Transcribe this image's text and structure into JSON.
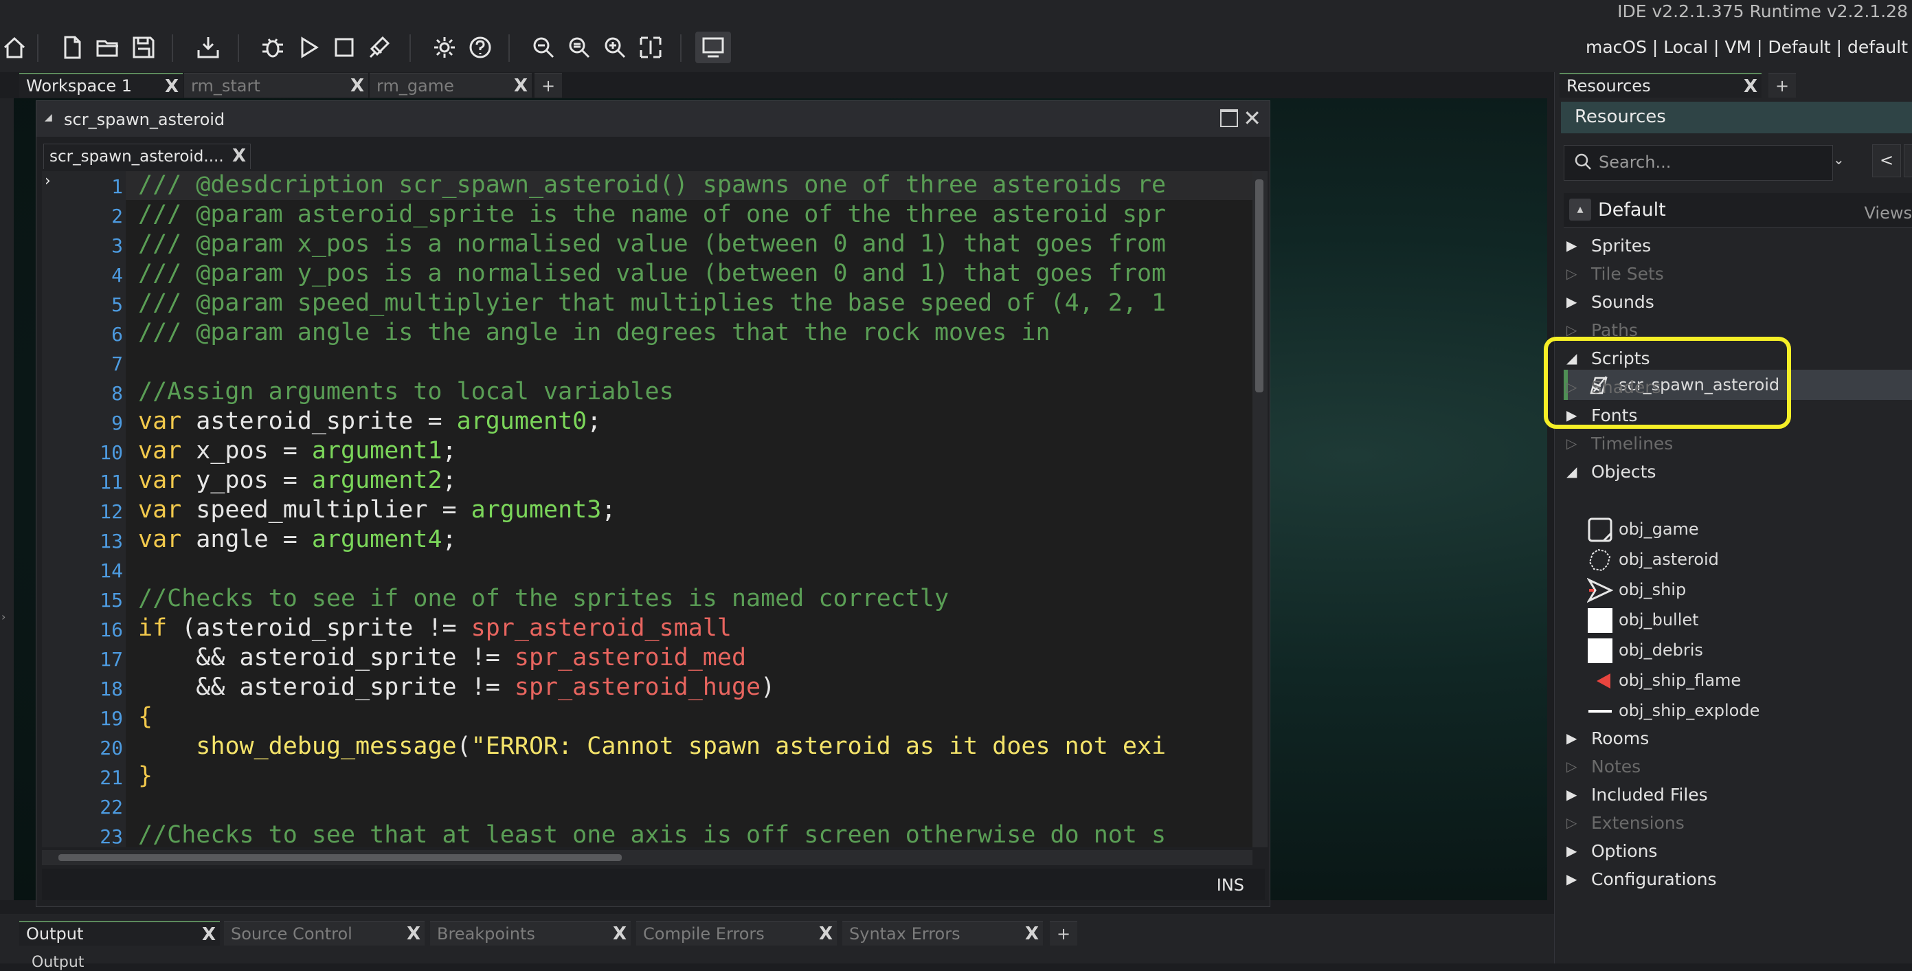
{
  "app": {
    "version": "IDE v2.2.1.375  Runtime v2.2.1.28",
    "target": "macOS | Local | VM | Default | default"
  },
  "toolbar": {
    "icons": [
      "home-icon",
      "new-file-icon",
      "open-folder-icon",
      "save-icon",
      "export-icon",
      "debug-icon",
      "play-icon",
      "stop-icon",
      "clean-icon",
      "settings-icon",
      "help-icon",
      "zoom-out-icon",
      "zoom-reset-icon",
      "zoom-in-icon",
      "fit-icon",
      "window-icon"
    ]
  },
  "workspace_tabs": [
    {
      "label": "Workspace 1",
      "active": true
    },
    {
      "label": "rm_start",
      "active": false
    },
    {
      "label": "rm_game",
      "active": false
    }
  ],
  "plus": "+",
  "code_window": {
    "title": "scr_spawn_asteroid",
    "subtab": "scr_spawn_asteroid....",
    "status": "INS",
    "line_numbers": [
      "1",
      "2",
      "3",
      "4",
      "5",
      "6",
      "7",
      "8",
      "9",
      "10",
      "11",
      "12",
      "13",
      "14",
      "15",
      "16",
      "17",
      "18",
      "19",
      "20",
      "21",
      "22",
      "23"
    ],
    "lines": [
      [
        {
          "c": "cm",
          "t": "/// @desdcription scr_spawn_asteroid() spawns one of three asteroids re"
        }
      ],
      [
        {
          "c": "cm",
          "t": "/// @param asteroid_sprite is the name of one of the three asteroid spr"
        }
      ],
      [
        {
          "c": "cm",
          "t": "/// @param x_pos is a normalised value (between 0 and 1) that goes from"
        }
      ],
      [
        {
          "c": "cm",
          "t": "/// @param y_pos is a normalised value (between 0 and 1) that goes from"
        }
      ],
      [
        {
          "c": "cm",
          "t": "/// @param speed_multiplyier that multiplies the base speed of (4, 2, 1"
        }
      ],
      [
        {
          "c": "cm",
          "t": "/// @param angle is the angle in degrees that the rock moves in"
        }
      ],
      [],
      [
        {
          "c": "cm",
          "t": "//Assign arguments to local variables"
        }
      ],
      [
        {
          "c": "kw",
          "t": "var"
        },
        {
          "c": "",
          "t": " asteroid_sprite = "
        },
        {
          "c": "arg",
          "t": "argument0"
        },
        {
          "c": "",
          "t": ";"
        }
      ],
      [
        {
          "c": "kw",
          "t": "var"
        },
        {
          "c": "",
          "t": " x_pos = "
        },
        {
          "c": "arg",
          "t": "argument1"
        },
        {
          "c": "",
          "t": ";"
        }
      ],
      [
        {
          "c": "kw",
          "t": "var"
        },
        {
          "c": "",
          "t": " y_pos = "
        },
        {
          "c": "arg",
          "t": "argument2"
        },
        {
          "c": "",
          "t": ";"
        }
      ],
      [
        {
          "c": "kw",
          "t": "var"
        },
        {
          "c": "",
          "t": " speed_multiplier = "
        },
        {
          "c": "arg",
          "t": "argument3"
        },
        {
          "c": "",
          "t": ";"
        }
      ],
      [
        {
          "c": "kw",
          "t": "var"
        },
        {
          "c": "",
          "t": " angle = "
        },
        {
          "c": "arg",
          "t": "argument4"
        },
        {
          "c": "",
          "t": ";"
        }
      ],
      [],
      [
        {
          "c": "cm",
          "t": "//Checks to see if one of the sprites is named correctly"
        }
      ],
      [
        {
          "c": "kw",
          "t": "if"
        },
        {
          "c": "",
          "t": " (asteroid_sprite != "
        },
        {
          "c": "res",
          "t": "spr_asteroid_small"
        }
      ],
      [
        {
          "c": "",
          "t": "    && asteroid_sprite != "
        },
        {
          "c": "res",
          "t": "spr_asteroid_med"
        }
      ],
      [
        {
          "c": "",
          "t": "    && asteroid_sprite != "
        },
        {
          "c": "res",
          "t": "spr_asteroid_huge"
        },
        {
          "c": "",
          "t": ")"
        }
      ],
      [
        {
          "c": "kw",
          "t": "{"
        }
      ],
      [
        {
          "c": "",
          "t": "    "
        },
        {
          "c": "str",
          "t": "show_debug_message"
        },
        {
          "c": "",
          "t": "("
        },
        {
          "c": "str",
          "t": "\"ERROR: Cannot spawn asteroid as it does not exi"
        }
      ],
      [
        {
          "c": "kw",
          "t": "}"
        }
      ],
      [],
      [
        {
          "c": "cm",
          "t": "//Checks to see that at least one axis is off screen otherwise do not s"
        }
      ]
    ]
  },
  "resources": {
    "tab_label": "Resources",
    "header": "Resources",
    "search_placeholder": "Search...",
    "nav_back": "<",
    "default_label": "Default",
    "views_label": "Views",
    "groups": [
      {
        "label": "Sprites",
        "state": "collapsed",
        "dim": false
      },
      {
        "label": "Tile Sets",
        "state": "collapsed",
        "dim": true
      },
      {
        "label": "Sounds",
        "state": "collapsed",
        "dim": false
      },
      {
        "label": "Paths",
        "state": "collapsed",
        "dim": true
      },
      {
        "label": "Scripts",
        "state": "expanded",
        "dim": false
      },
      {
        "label": "Shaders",
        "state": "collapsed",
        "dim": true
      },
      {
        "label": "Fonts",
        "state": "collapsed",
        "dim": false
      },
      {
        "label": "Timelines",
        "state": "collapsed",
        "dim": true
      },
      {
        "label": "Objects",
        "state": "expanded",
        "dim": false
      },
      {
        "label": "Rooms",
        "state": "collapsed",
        "dim": false
      },
      {
        "label": "Notes",
        "state": "collapsed",
        "dim": true
      },
      {
        "label": "Included Files",
        "state": "collapsed",
        "dim": false
      },
      {
        "label": "Extensions",
        "state": "collapsed",
        "dim": true
      },
      {
        "label": "Options",
        "state": "collapsed",
        "dim": false
      },
      {
        "label": "Configurations",
        "state": "collapsed",
        "dim": false
      }
    ],
    "script_item": "scr_spawn_asteroid",
    "objects": [
      {
        "label": "obj_game",
        "icon": "box-outline-icon"
      },
      {
        "label": "obj_asteroid",
        "icon": "asteroid-outline-icon"
      },
      {
        "label": "obj_ship",
        "icon": "ship-icon"
      },
      {
        "label": "obj_bullet",
        "icon": "white-square-icon"
      },
      {
        "label": "obj_debris",
        "icon": "white-square-icon"
      },
      {
        "label": "obj_ship_flame",
        "icon": "flame-icon"
      },
      {
        "label": "obj_ship_explode",
        "icon": "line-icon"
      }
    ],
    "highlight_color": "#f5ef27"
  },
  "bottom_tabs": [
    {
      "label": "Output",
      "active": true
    },
    {
      "label": "Source Control",
      "active": false
    },
    {
      "label": "Breakpoints",
      "active": false
    },
    {
      "label": "Compile Errors",
      "active": false
    },
    {
      "label": "Syntax Errors",
      "active": false
    }
  ],
  "output_label": "Output"
}
